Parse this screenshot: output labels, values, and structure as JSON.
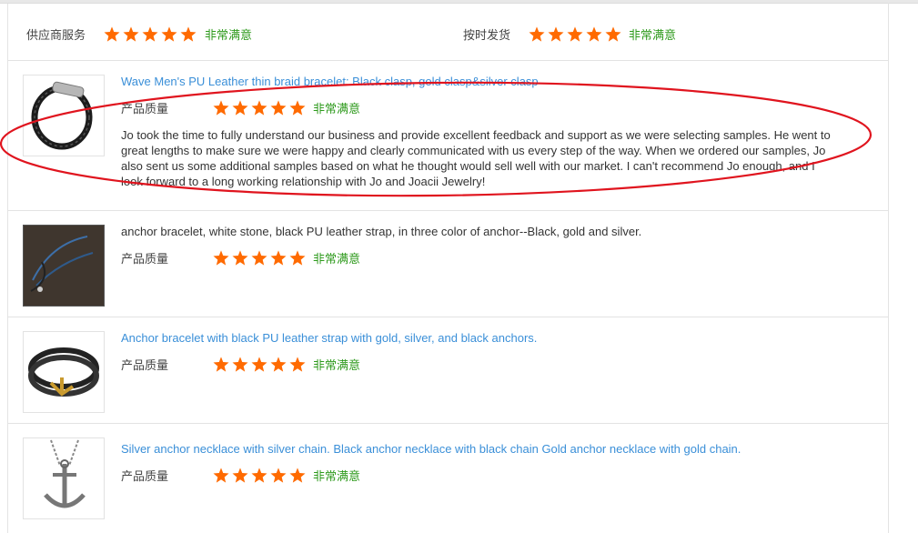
{
  "summary": {
    "supplier_service_label": "供应商服务",
    "supplier_service_rating": 5,
    "supplier_service_text": "非常满意",
    "ontime_label": "按时发货",
    "ontime_rating": 5,
    "ontime_text": "非常满意"
  },
  "colors": {
    "star": "#ff6a00",
    "satisfied": "#2e9a1c",
    "link": "#3a8fd8",
    "highlight": "#e0141e"
  },
  "reviews": [
    {
      "title": "Wave Men's PU Leather thin braid bracelet: Black clasp, gold clasp&silver clasp",
      "quality_label": "产品质量",
      "rating": 5,
      "rating_text": "非常满意",
      "comment": "Jo took the time to fully understand our business and provide excellent feedback and support as we were selecting samples. He went to great lengths to make sure we were happy and clearly communicated with us every step of the way. When we ordered our samples, Jo also sent us some additional samples based on what he thought would sell well with our market. I can't recommend Jo enough, and I look forward to a long working relationship with Jo and Joacii Jewelry!",
      "image_icon": "braided-bracelet-icon"
    },
    {
      "title": "anchor bracelet, white stone, black PU leather strap, in three color of anchor--Black, gold and silver.",
      "quality_label": "产品质量",
      "rating": 5,
      "rating_text": "非常满意",
      "image_icon": "anchor-bracelet-photo-icon"
    },
    {
      "title": "Anchor bracelet with black PU leather strap with gold, silver, and black anchors.",
      "quality_label": "产品质量",
      "rating": 5,
      "rating_text": "非常满意",
      "image_icon": "wrap-anchor-bracelet-icon"
    },
    {
      "title": "Silver anchor necklace with silver chain. Black anchor necklace with black chain Gold anchor necklace with gold chain.",
      "quality_label": "产品质量",
      "rating": 5,
      "rating_text": "非常满意",
      "image_icon": "anchor-necklace-icon"
    }
  ]
}
